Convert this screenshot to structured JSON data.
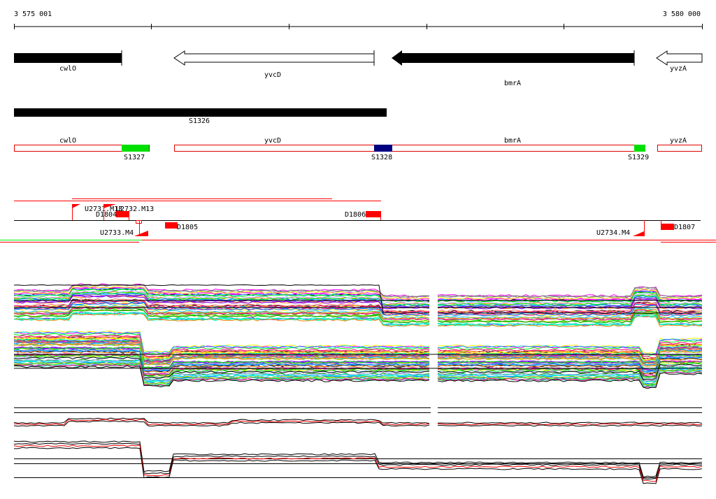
{
  "ruler": {
    "start_label": "3 575 001",
    "end_label": "3 580 000"
  },
  "genes": [
    {
      "name": "cwlO",
      "strand": "+",
      "filled": true
    },
    {
      "name": "yvcD",
      "strand": "-",
      "filled": false
    },
    {
      "name": "bmrA",
      "strand": "-",
      "filled": true
    },
    {
      "name": "yvzA",
      "strand": "-",
      "filled": false
    }
  ],
  "segment_track": {
    "label": "S1326"
  },
  "gene_boxes": [
    {
      "name": "cwlO"
    },
    {
      "name": "yvcD"
    },
    {
      "name": "bmrA"
    },
    {
      "name": "yvzA"
    }
  ],
  "segments": [
    {
      "name": "S1327",
      "color": "#00e000"
    },
    {
      "name": "S1328",
      "color": "#000080"
    },
    {
      "name": "S1329",
      "color": "#00e000"
    }
  ],
  "features": {
    "upstream": [
      "U2731.M13",
      "U2732.M13",
      "U2733.M4",
      "U2734.M4"
    ],
    "downstream": [
      "D1804",
      "D1806",
      "D1805",
      "D1807"
    ]
  },
  "colors": {
    "accent": "#ff0000",
    "segment_green": "#00e000",
    "segment_navy": "#000080"
  }
}
